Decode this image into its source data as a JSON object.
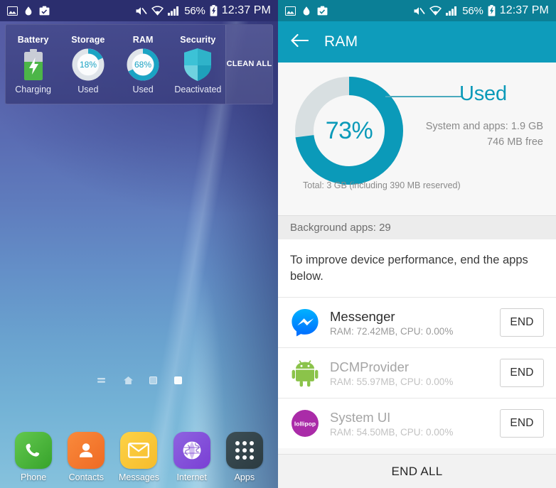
{
  "left_phone": {
    "statusbar": {
      "icons_left": [
        "image-icon",
        "droplet-icon",
        "work-profile-icon"
      ],
      "icons_right": [
        "mute-icon",
        "wifi-icon",
        "signal-icon"
      ],
      "battery_percent": "56%",
      "battery_icon": "battery-charging-icon",
      "time": "12:37 PM"
    },
    "quick_panel": {
      "items": [
        {
          "title": "Battery",
          "sub": "Charging",
          "art": "battery-charging-icon",
          "percent": null
        },
        {
          "title": "Storage",
          "sub": "Used",
          "art": "donut-icon",
          "percent": "18%",
          "value": 18
        },
        {
          "title": "RAM",
          "sub": "Used",
          "art": "donut-icon",
          "percent": "68%",
          "value": 68
        },
        {
          "title": "Security",
          "sub": "Deactivated",
          "art": "shield-icon",
          "percent": null
        }
      ],
      "clean_all_label": "CLEAN ALL"
    },
    "page_indicator": {
      "icons": [
        "list-icon",
        "home-icon"
      ],
      "pages": 2,
      "active_page": 2
    },
    "dock": [
      {
        "label": "Phone",
        "icon": "phone-icon"
      },
      {
        "label": "Contacts",
        "icon": "contacts-icon"
      },
      {
        "label": "Messages",
        "icon": "messages-icon"
      },
      {
        "label": "Internet",
        "icon": "internet-icon"
      },
      {
        "label": "Apps",
        "icon": "apps-grid-icon"
      }
    ]
  },
  "right_phone": {
    "statusbar": {
      "icons_left": [
        "image-icon",
        "droplet-icon",
        "work-profile-icon"
      ],
      "icons_right": [
        "mute-icon",
        "wifi-icon",
        "signal-icon"
      ],
      "battery_percent": "56%",
      "battery_icon": "battery-charging-icon",
      "time": "12:37 PM"
    },
    "appbar": {
      "back_icon": "back-arrow-icon",
      "title": "RAM"
    },
    "ram": {
      "percent_label": "73%",
      "percent_value": 73,
      "used_label": "Used",
      "system_and_apps": "System and apps: 1.9 GB",
      "free": "746 MB free",
      "total": "Total: 3 GB (including 390 MB reserved)"
    },
    "background_apps_label": "Background apps: 29",
    "hint": "To improve device performance, end the apps below.",
    "apps": [
      {
        "name": "Messenger",
        "stats": "RAM: 72.42MB, CPU: 0.00%",
        "icon": "messenger-icon",
        "end_label": "END",
        "dim": false
      },
      {
        "name": "DCMProvider",
        "stats": "RAM: 55.97MB, CPU: 0.00%",
        "icon": "android-icon",
        "end_label": "END",
        "dim": true
      },
      {
        "name": "System UI",
        "stats": "RAM: 54.50MB, CPU: 0.00%",
        "icon": "lollipop-icon",
        "end_label": "END",
        "dim": true
      }
    ],
    "end_all_label": "END ALL"
  },
  "colors": {
    "teal_accent": "#0b9ab9",
    "appbar_teal": "#0e9cbb",
    "statusbar_teal": "#0b7f96",
    "statusbar_blue": "#2b2e6e",
    "donut_track": "#d8dfe1",
    "charging_green": "#4cb648"
  }
}
